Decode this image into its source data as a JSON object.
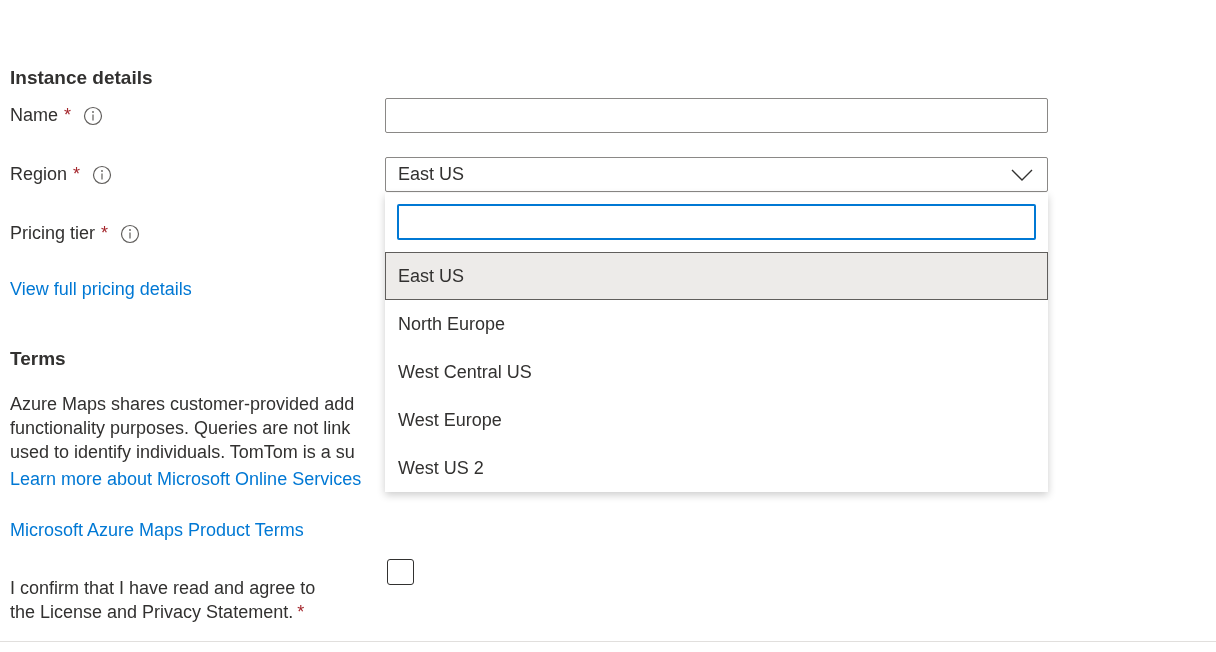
{
  "instance_details": {
    "heading": "Instance details",
    "fields": [
      {
        "label": "Name",
        "required_mark": "*",
        "kind": "text"
      },
      {
        "label": "Region",
        "required_mark": "*",
        "kind": "select",
        "value": "East US",
        "expanded": true,
        "options": [
          {
            "label": "East US",
            "selected": true
          },
          {
            "label": "North Europe",
            "selected": false
          },
          {
            "label": "West Central US",
            "selected": false
          },
          {
            "label": "West Europe",
            "selected": false
          },
          {
            "label": "West US 2",
            "selected": false
          }
        ]
      },
      {
        "label": "Pricing tier",
        "required_mark": "*",
        "kind": "hidden"
      }
    ],
    "pricing_link": "View full pricing details"
  },
  "terms": {
    "heading": "Terms",
    "paragraph_lines": [
      "Azure Maps shares customer-provided add",
      "functionality purposes. Queries are not link",
      "used to identify individuals. TomTom is a su"
    ],
    "subprocessor_link": "Learn more about Microsoft Online Services",
    "product_terms_link": "Microsoft Azure Maps Product Terms",
    "confirm": {
      "label_lines": [
        "I confirm that I have read and agree to",
        "the License and Privacy Statement."
      ],
      "required_mark": "*",
      "checked": false
    }
  }
}
